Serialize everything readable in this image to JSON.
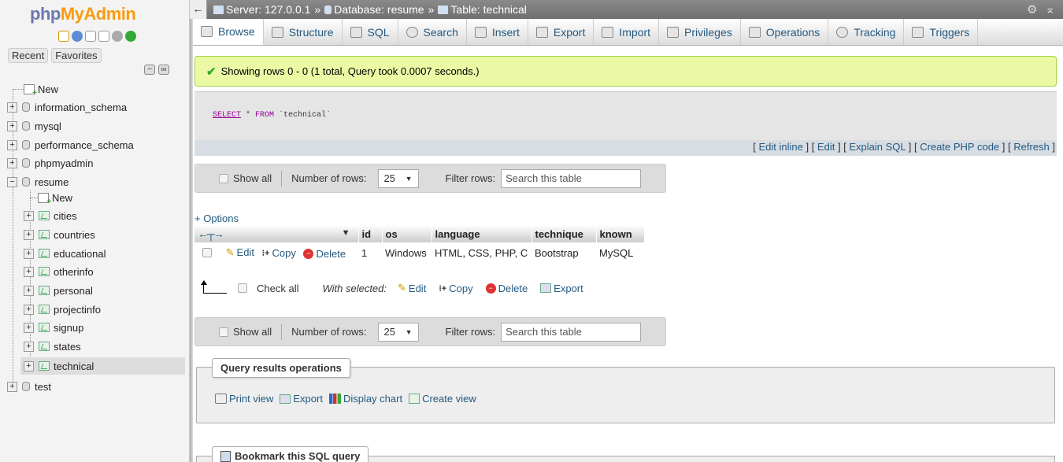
{
  "sidebar": {
    "logo_php": "php",
    "logo_myadmin": "MyAdmin",
    "recent": "Recent",
    "favorites": "Favorites",
    "tree": {
      "new_root": "New",
      "databases": [
        "information_schema",
        "mysql",
        "performance_schema",
        "phpmyadmin",
        "resume"
      ],
      "resume_new": "New",
      "tables": [
        "cities",
        "countries",
        "educational",
        "otherinfo",
        "personal",
        "projectinfo",
        "signup",
        "states",
        "technical"
      ],
      "last_db": "test"
    }
  },
  "topbar": {
    "server": "Server: 127.0.0.1",
    "database": "Database: resume",
    "table": "Table: technical",
    "separator": "»"
  },
  "tabs": [
    "Browse",
    "Structure",
    "SQL",
    "Search",
    "Insert",
    "Export",
    "Import",
    "Privileges",
    "Operations",
    "Tracking",
    "Triggers"
  ],
  "message": "Showing rows 0 - 0 (1 total, Query took 0.0007 seconds.)",
  "sql": {
    "kw_select": "SELECT",
    "rest1": " * ",
    "kw_from": "FROM",
    "table": " `technical`"
  },
  "sql_links": {
    "edit_inline": "Edit inline",
    "edit": "Edit",
    "explain": "Explain SQL",
    "create_php": "Create PHP code",
    "refresh": "Refresh"
  },
  "nav": {
    "show_all": "Show all",
    "number_of_rows": "Number of rows:",
    "rows_value": "25",
    "filter_rows": "Filter rows:",
    "filter_placeholder": "Search this table"
  },
  "options": "+ Options",
  "table": {
    "columns": [
      "id",
      "os",
      "language",
      "technique",
      "known"
    ],
    "rows": [
      {
        "id": "1",
        "os": "Windows",
        "language": "HTML, CSS, PHP, C",
        "technique": "Bootstrap",
        "known": "MySQL"
      }
    ],
    "row_actions": {
      "edit": "Edit",
      "copy": "Copy",
      "delete": "Delete"
    }
  },
  "with_selected": {
    "check_all": "Check all",
    "label": "With selected:",
    "edit": "Edit",
    "copy": "Copy",
    "delete": "Delete",
    "export": "Export"
  },
  "query_ops": {
    "legend": "Query results operations",
    "print_view": "Print view",
    "export": "Export",
    "display_chart": "Display chart",
    "create_view": "Create view"
  },
  "bookmark": {
    "legend": "Bookmark this SQL query"
  }
}
